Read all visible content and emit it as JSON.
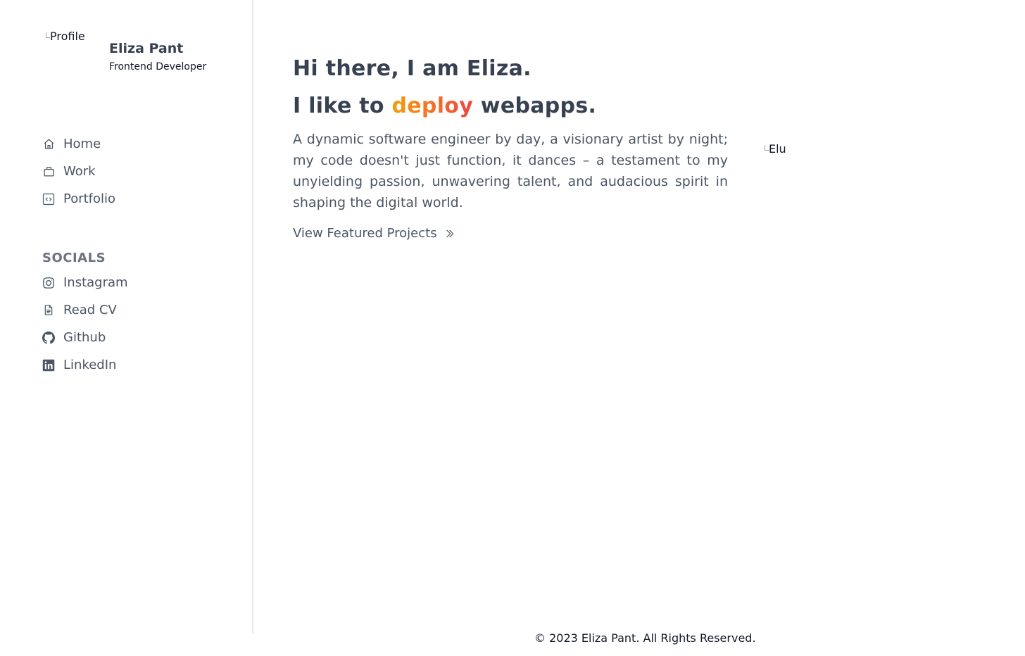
{
  "profile": {
    "image_alt": "Profile",
    "name": "Eliza Pant",
    "role": "Frontend Developer"
  },
  "nav": {
    "items": [
      {
        "label": "Home",
        "icon": "home-icon"
      },
      {
        "label": "Work",
        "icon": "briefcase-icon"
      },
      {
        "label": "Portfolio",
        "icon": "code-icon"
      }
    ]
  },
  "socials": {
    "title": "SOCIALS",
    "items": [
      {
        "label": "Instagram",
        "icon": "instagram-icon"
      },
      {
        "label": "Read CV",
        "icon": "document-icon"
      },
      {
        "label": "Github",
        "icon": "github-icon"
      },
      {
        "label": "LinkedIn",
        "icon": "linkedin-icon"
      }
    ]
  },
  "hero": {
    "greeting": "Hi there, I am Eliza.",
    "tagline_prefix": "I like to ",
    "tagline_accent": "deploy",
    "tagline_suffix": " webapps.",
    "bio": "A dynamic software engineer by day, a visionary artist by night; my code doesn't just function, it dances – a testament to my unyielding passion, unwavering talent, and audacious spirit in shaping the digital world.",
    "cta_label": "View Featured Projects",
    "image_alt": "Elu"
  },
  "footer": {
    "text": "© 2023 Eliza Pant. All Rights Reserved."
  },
  "colors": {
    "text": "#374151",
    "muted": "#6b7280",
    "accent_start": "#f59e0b",
    "accent_end": "#ef4444",
    "divider": "#e5e7eb"
  }
}
